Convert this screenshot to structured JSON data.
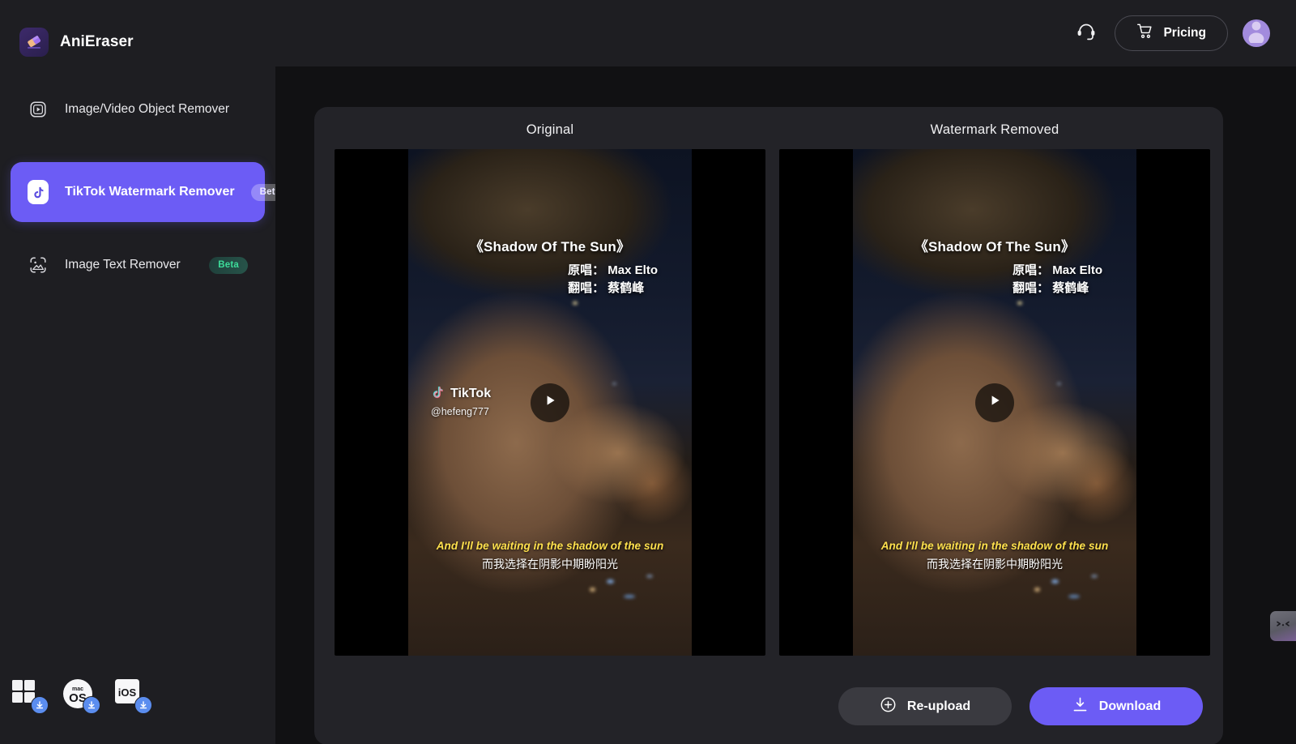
{
  "app": {
    "brand_name": "AniEraser",
    "logo_icon": "eraser-icon"
  },
  "sidebar": {
    "items": [
      {
        "label": "Image/Video Object Remover",
        "icon": "play-square-icon",
        "badge": "",
        "active": false
      },
      {
        "label": "TikTok Watermark Remover",
        "icon": "tiktok-icon",
        "badge": "Beta",
        "active": true
      },
      {
        "label": "Image Text Remover",
        "icon": "image-text-icon",
        "badge": "Beta",
        "active": false
      }
    ],
    "downloads": [
      {
        "platform": "Windows",
        "icon": "windows-icon",
        "action_icon": "download-arrow-icon"
      },
      {
        "platform": "macOS",
        "label_top": "mac",
        "label_main": "OS",
        "icon": "macos-icon",
        "action_icon": "download-arrow-icon"
      },
      {
        "platform": "iOS",
        "label_main": "iOS",
        "icon": "ios-icon",
        "action_icon": "download-arrow-icon"
      }
    ]
  },
  "header": {
    "support_icon": "headset-icon",
    "pricing_label": "Pricing",
    "pricing_icon": "cart-icon",
    "avatar_icon": "user-avatar-icon"
  },
  "main": {
    "columns": [
      {
        "title": "Original",
        "has_watermark": true
      },
      {
        "title": "Watermark Removed",
        "has_watermark": false
      }
    ],
    "video": {
      "title_overlay": "《Shadow Of The Sun》",
      "credit_original": "原唱： Max Elto",
      "credit_cover": "翻唱：  蔡鹤峰",
      "watermark_brand": "TikTok",
      "watermark_user": "@hefeng777",
      "subtitle_en": "And I'll be waiting in the shadow of the sun",
      "subtitle_zh": "而我选择在阴影中期盼阳光",
      "play_icon": "play-icon"
    },
    "actions": {
      "reupload_label": "Re-upload",
      "reupload_icon": "plus-circle-icon",
      "download_label": "Download",
      "download_icon": "download-icon"
    }
  },
  "feedback": {
    "tab_face": "&gt;.&lt;",
    "icon": "feedback-face-icon"
  },
  "colors": {
    "accent": "#6c5cf5",
    "sidebar_bg": "#1e1e22",
    "stage_bg": "#111113",
    "card_bg": "#232328",
    "badge_green": "#3ddc9a",
    "subtitle_yellow": "#ffe14d",
    "download_blue": "#5b8def"
  }
}
